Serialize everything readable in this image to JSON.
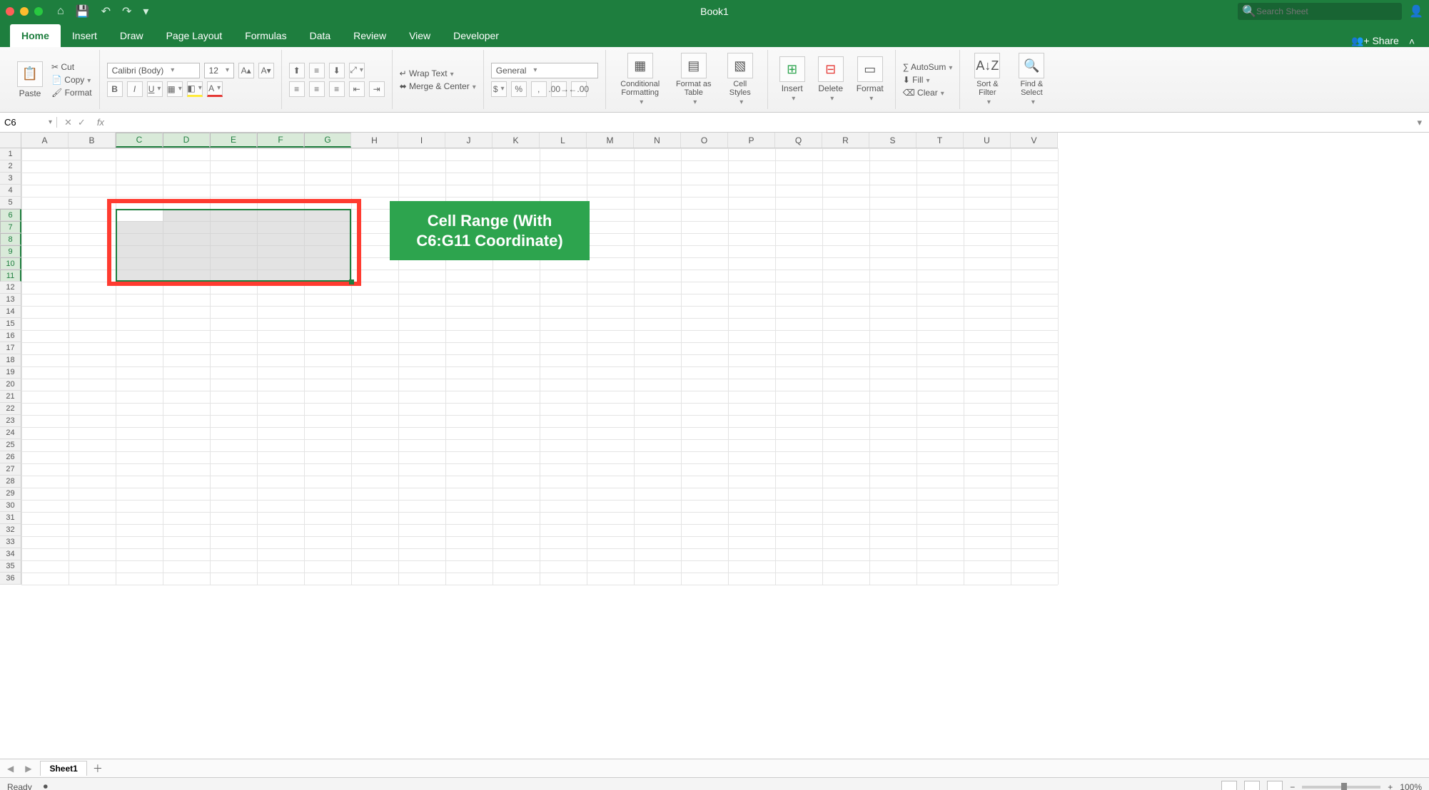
{
  "titlebar": {
    "title": "Book1",
    "search_placeholder": "Search Sheet"
  },
  "tabs": {
    "items": [
      "Home",
      "Insert",
      "Draw",
      "Page Layout",
      "Formulas",
      "Data",
      "Review",
      "View",
      "Developer"
    ],
    "active": "Home",
    "share": "Share"
  },
  "ribbon": {
    "paste": "Paste",
    "cut": "Cut",
    "copy": "Copy",
    "format_painter": "Format",
    "font_name": "Calibri (Body)",
    "font_size": "12",
    "wrap": "Wrap Text",
    "merge": "Merge & Center",
    "numfmt": "General",
    "cond": "Conditional Formatting",
    "ftable": "Format as Table",
    "cstyles": "Cell Styles",
    "insert": "Insert",
    "delete": "Delete",
    "format": "Format",
    "autosum": "AutoSum",
    "fill": "Fill",
    "clear": "Clear",
    "sort": "Sort & Filter",
    "find": "Find & Select"
  },
  "formula": {
    "namebox": "C6",
    "fx": "fx",
    "value": ""
  },
  "grid": {
    "columns": [
      "A",
      "B",
      "C",
      "D",
      "E",
      "F",
      "G",
      "H",
      "I",
      "J",
      "K",
      "L",
      "M",
      "N",
      "O",
      "P",
      "Q",
      "R",
      "S",
      "T",
      "U",
      "V"
    ],
    "selected_cols": [
      "C",
      "D",
      "E",
      "F",
      "G"
    ],
    "rows": 36,
    "selected_rows": [
      6,
      7,
      8,
      9,
      10,
      11
    ],
    "selection": "C6:G11",
    "active_cell": "C6",
    "callout": "Cell Range (With C6:G11 Coordinate)"
  },
  "sheets": {
    "active": "Sheet1"
  },
  "status": {
    "ready": "Ready",
    "zoom": "100%"
  }
}
